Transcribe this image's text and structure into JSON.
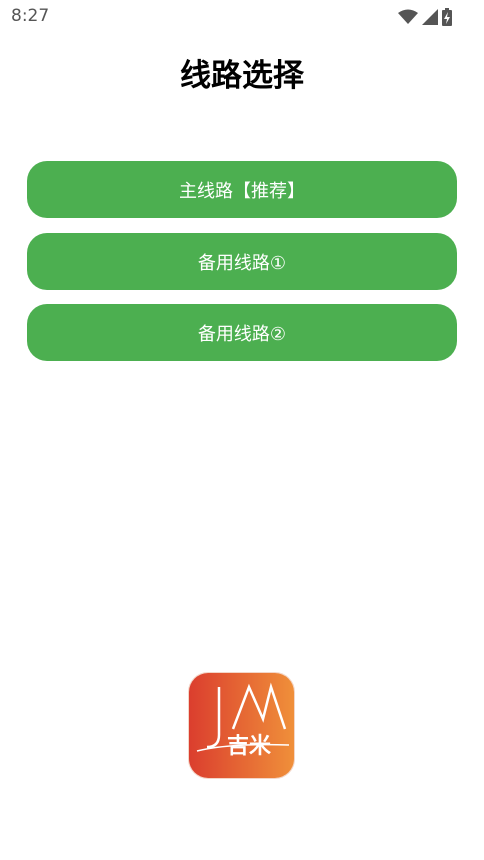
{
  "status_bar": {
    "time": "8:27",
    "icons": [
      "wifi-icon",
      "cellular-signal-icon",
      "battery-charging-icon"
    ]
  },
  "page": {
    "title": "线路选择"
  },
  "routes": [
    {
      "label": "主线路【推荐】"
    },
    {
      "label": "备用线路①"
    },
    {
      "label": "备用线路②"
    }
  ],
  "logo": {
    "text": "吉米",
    "letters": "JM"
  },
  "colors": {
    "button_green": "#4caf50",
    "logo_gradient_start": "#db3e2e",
    "logo_gradient_end": "#f0913a"
  }
}
